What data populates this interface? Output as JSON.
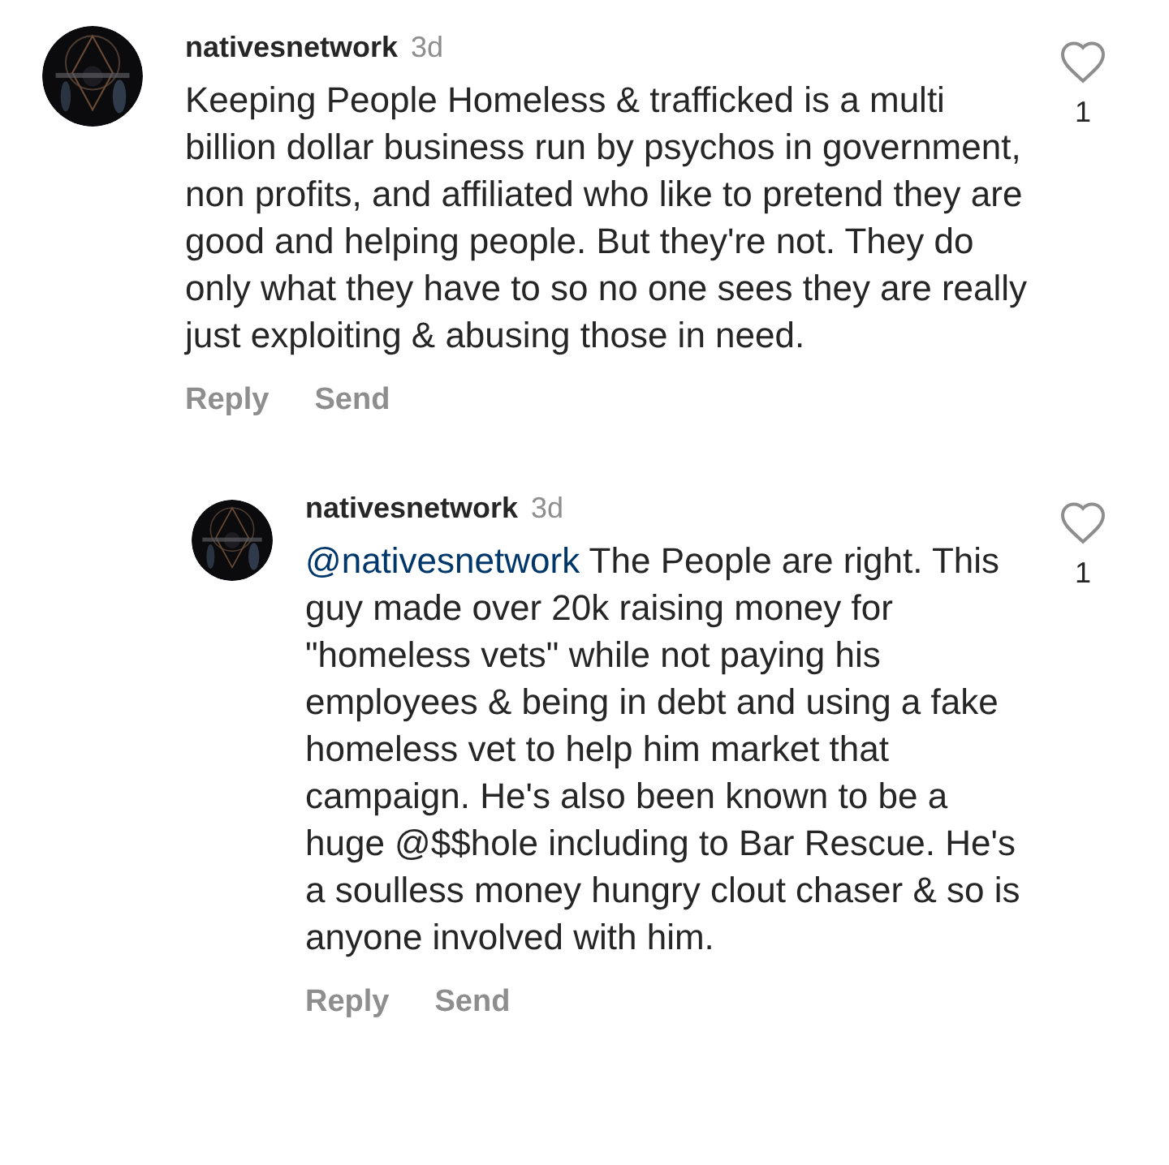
{
  "comments": [
    {
      "username": "nativesnetwork",
      "time": "3d",
      "text": "Keeping People Homeless & trafficked is a multi billion dollar business run by psychos in government, non profits, and affiliated who like to pretend they are good and helping people. But they're not. They do only what they have to so no one sees they are really just exploiting & abusing those in need.",
      "liked": false,
      "likes": "1",
      "actions": [
        "Reply",
        "Send"
      ],
      "replies": [
        {
          "username": "nativesnetwork",
          "time": "3d",
          "mention": "@nativesnetwork",
          "text": "The People are right. This guy made over 20k raising money for \"homeless vets\" while not paying his employees & being in debt and using a fake homeless vet to help him market that campaign. He's also been known to be a huge @$$hole including to Bar Rescue. He's a soulless money hungry clout chaser & so is anyone involved with him.",
          "liked": false,
          "likes": "1",
          "actions": [
            "Reply",
            "Send"
          ]
        }
      ]
    }
  ]
}
